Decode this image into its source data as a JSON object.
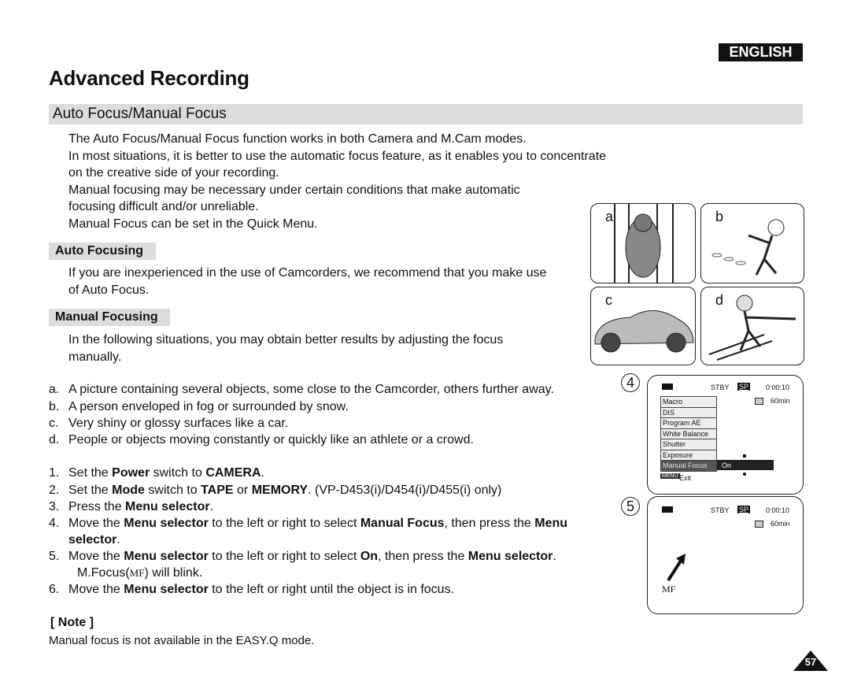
{
  "language_badge": "ENGLISH",
  "title": "Advanced Recording",
  "section": "Auto Focus/Manual Focus",
  "intro": [
    "The Auto Focus/Manual Focus function works in both Camera and M.Cam modes.",
    "In most situations, it is better to use the automatic focus feature, as it enables you to concentrate",
    "on the creative side of your recording.",
    "Manual focusing may be necessary under certain conditions that make automatic",
    "focusing difficult and/or unreliable.",
    "Manual Focus can be set in the Quick Menu."
  ],
  "auto_focusing": {
    "heading": "Auto Focusing",
    "lines": [
      "If you are inexperienced in the use of Camcorders, we recommend that you make use",
      "of Auto Focus."
    ]
  },
  "manual_focusing": {
    "heading": "Manual Focusing",
    "lines": [
      "In the following situations, you may obtain better results by adjusting the focus",
      "manually."
    ]
  },
  "situations": [
    {
      "label": "a.",
      "text": "A picture containing several objects, some close to the Camcorder, others further away."
    },
    {
      "label": "b.",
      "text": "A person enveloped in fog or surrounded by snow."
    },
    {
      "label": "c.",
      "text": "Very shiny or glossy surfaces like a car."
    },
    {
      "label": "d.",
      "text": "People or objects moving constantly or quickly like an athlete or a crowd."
    }
  ],
  "steps": [
    {
      "label": "1.",
      "lines": [
        [
          [
            "Set the ",
            0
          ],
          [
            "Power",
            1
          ],
          [
            " switch to ",
            0
          ],
          [
            "CAMERA",
            1
          ],
          [
            ".",
            0
          ]
        ]
      ]
    },
    {
      "label": "2.",
      "lines": [
        [
          [
            "Set the ",
            0
          ],
          [
            "Mode",
            1
          ],
          [
            " switch to ",
            0
          ],
          [
            "TAPE",
            1
          ],
          [
            " or ",
            0
          ],
          [
            "MEMORY",
            1
          ],
          [
            ". (VP-D453(i)/D454(i)/D455(i) only)",
            0
          ]
        ]
      ]
    },
    {
      "label": "3.",
      "lines": [
        [
          [
            "Press the ",
            0
          ],
          [
            "Menu selector",
            1
          ],
          [
            ".",
            0
          ]
        ]
      ]
    },
    {
      "label": "4.",
      "lines": [
        [
          [
            "Move the ",
            0
          ],
          [
            "Menu selector",
            1
          ],
          [
            " to the left or right to select ",
            0
          ],
          [
            "Manual Focus",
            1
          ],
          [
            ", then press the ",
            0
          ],
          [
            "Menu",
            1
          ]
        ],
        [
          [
            "selector",
            1
          ],
          [
            ".",
            0
          ]
        ]
      ]
    },
    {
      "label": "5.",
      "lines": [
        [
          [
            "Move the ",
            0
          ],
          [
            "Menu selector",
            1
          ],
          [
            " to the left or right to select ",
            0
          ],
          [
            "On",
            1
          ],
          [
            ", then press the ",
            0
          ],
          [
            "Menu selector",
            1
          ],
          [
            ".",
            0
          ]
        ],
        [
          [
            "M.Focus(",
            0
          ],
          [
            "MF",
            2
          ],
          [
            ") will blink.",
            0
          ]
        ]
      ]
    },
    {
      "label": "6.",
      "lines": [
        [
          [
            "Move the ",
            0
          ],
          [
            "Menu selector",
            1
          ],
          [
            " to the left or right until the object is in focus.",
            0
          ]
        ]
      ]
    }
  ],
  "note": {
    "heading": "[ Note ]",
    "text": "Manual focus is not available in the EASY.Q mode."
  },
  "illustrations": [
    "a",
    "b",
    "c",
    "d"
  ],
  "lcd4": {
    "number": "4",
    "status": "STBY",
    "mode": "SP",
    "time": "0:00:10",
    "tape": "60min",
    "menu": [
      "Macro",
      "DIS",
      "Program AE",
      "White Balance",
      "Shutter",
      "Exposure",
      "Manual Focus"
    ],
    "selected_value": "On",
    "menu_key": "MENU",
    "exit": "Exit"
  },
  "lcd5": {
    "number": "5",
    "status": "STBY",
    "mode": "SP",
    "time": "0:00:10",
    "tape": "60min",
    "indicator": "MF"
  },
  "page_number": "57"
}
